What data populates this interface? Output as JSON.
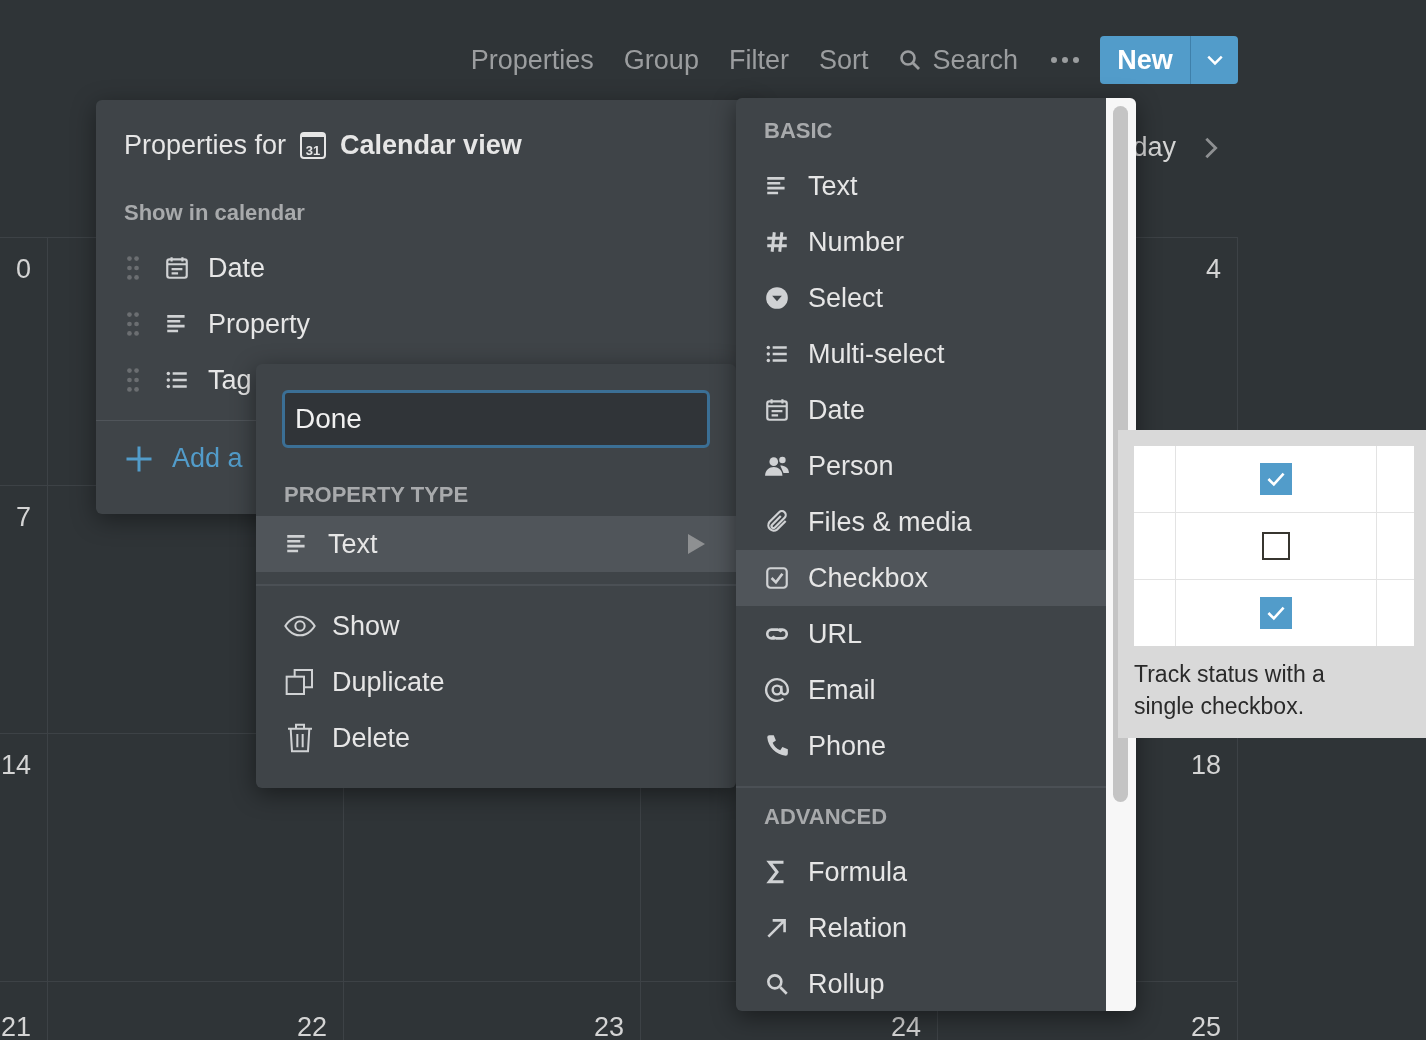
{
  "toolbar": {
    "items": [
      {
        "label": "Properties"
      },
      {
        "label": "Group"
      },
      {
        "label": "Filter"
      },
      {
        "label": "Sort"
      }
    ],
    "search": {
      "label": "Search"
    },
    "new_button": {
      "label": "New"
    }
  },
  "calendar": {
    "nav_label": "day",
    "weeks": [
      {
        "col_1": "0",
        "col_5": "4"
      },
      {
        "col_1": "7"
      },
      {
        "col_1": "14",
        "col_5": "18"
      },
      {
        "col_1": "21",
        "col_2": "22",
        "col_3": "23",
        "col_4": "24",
        "col_5": "25"
      }
    ]
  },
  "properties_panel": {
    "title": "Properties for",
    "view_icon_label": "31",
    "view_name": "Calendar view",
    "section": "Show in calendar",
    "items": [
      {
        "label": "Date",
        "kind": "date"
      },
      {
        "label": "Property",
        "kind": "text"
      },
      {
        "label": "Tag",
        "kind": "multi_select"
      }
    ],
    "add_label": "Add a"
  },
  "edit_popover": {
    "name_input": {
      "value": "Done"
    },
    "section": "PROPERTY TYPE",
    "type_row": {
      "label": "Text",
      "kind": "text",
      "selected": true
    },
    "actions": [
      {
        "label": "Show",
        "kind": "show"
      },
      {
        "label": "Duplicate",
        "kind": "duplicate"
      },
      {
        "label": "Delete",
        "kind": "delete"
      }
    ]
  },
  "type_menu": {
    "sections": [
      {
        "title": "BASIC",
        "items": [
          {
            "label": "Text",
            "kind": "text",
            "selected": false
          },
          {
            "label": "Number",
            "kind": "number",
            "selected": false
          },
          {
            "label": "Select",
            "kind": "select",
            "selected": false
          },
          {
            "label": "Multi-select",
            "kind": "multi_select",
            "selected": false
          },
          {
            "label": "Date",
            "kind": "date",
            "selected": false
          },
          {
            "label": "Person",
            "kind": "person",
            "selected": false
          },
          {
            "label": "Files & media",
            "kind": "files",
            "selected": false
          },
          {
            "label": "Checkbox",
            "kind": "checkbox",
            "selected": true
          },
          {
            "label": "URL",
            "kind": "url",
            "selected": false
          },
          {
            "label": "Email",
            "kind": "email",
            "selected": false
          },
          {
            "label": "Phone",
            "kind": "phone",
            "selected": false
          }
        ]
      },
      {
        "title": "ADVANCED",
        "items": [
          {
            "label": "Formula",
            "kind": "formula",
            "selected": false
          },
          {
            "label": "Relation",
            "kind": "relation",
            "selected": false
          },
          {
            "label": "Rollup",
            "kind": "rollup",
            "selected": false
          }
        ]
      }
    ]
  },
  "preview": {
    "rows": [
      {
        "checked": true
      },
      {
        "checked": false
      },
      {
        "checked": true
      }
    ],
    "caption": "Track status with a single checkbox."
  }
}
